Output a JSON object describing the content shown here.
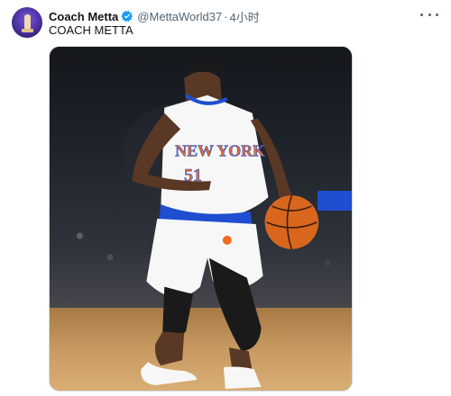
{
  "tweet": {
    "author_name": "Coach Metta",
    "handle": "@MettaWorld37",
    "separator": "·",
    "time": "4小时",
    "text": "COACH METTA"
  },
  "icons": {
    "verified": "verified-badge-icon",
    "more": "more-options-icon"
  },
  "media": {
    "jersey_text": "NEW YORK",
    "jersey_number": "51"
  },
  "colors": {
    "verified_blue": "#1d9bf0",
    "knicks_orange": "#f26b21",
    "knicks_blue": "#1f4ed1",
    "muted_text": "#536471"
  }
}
